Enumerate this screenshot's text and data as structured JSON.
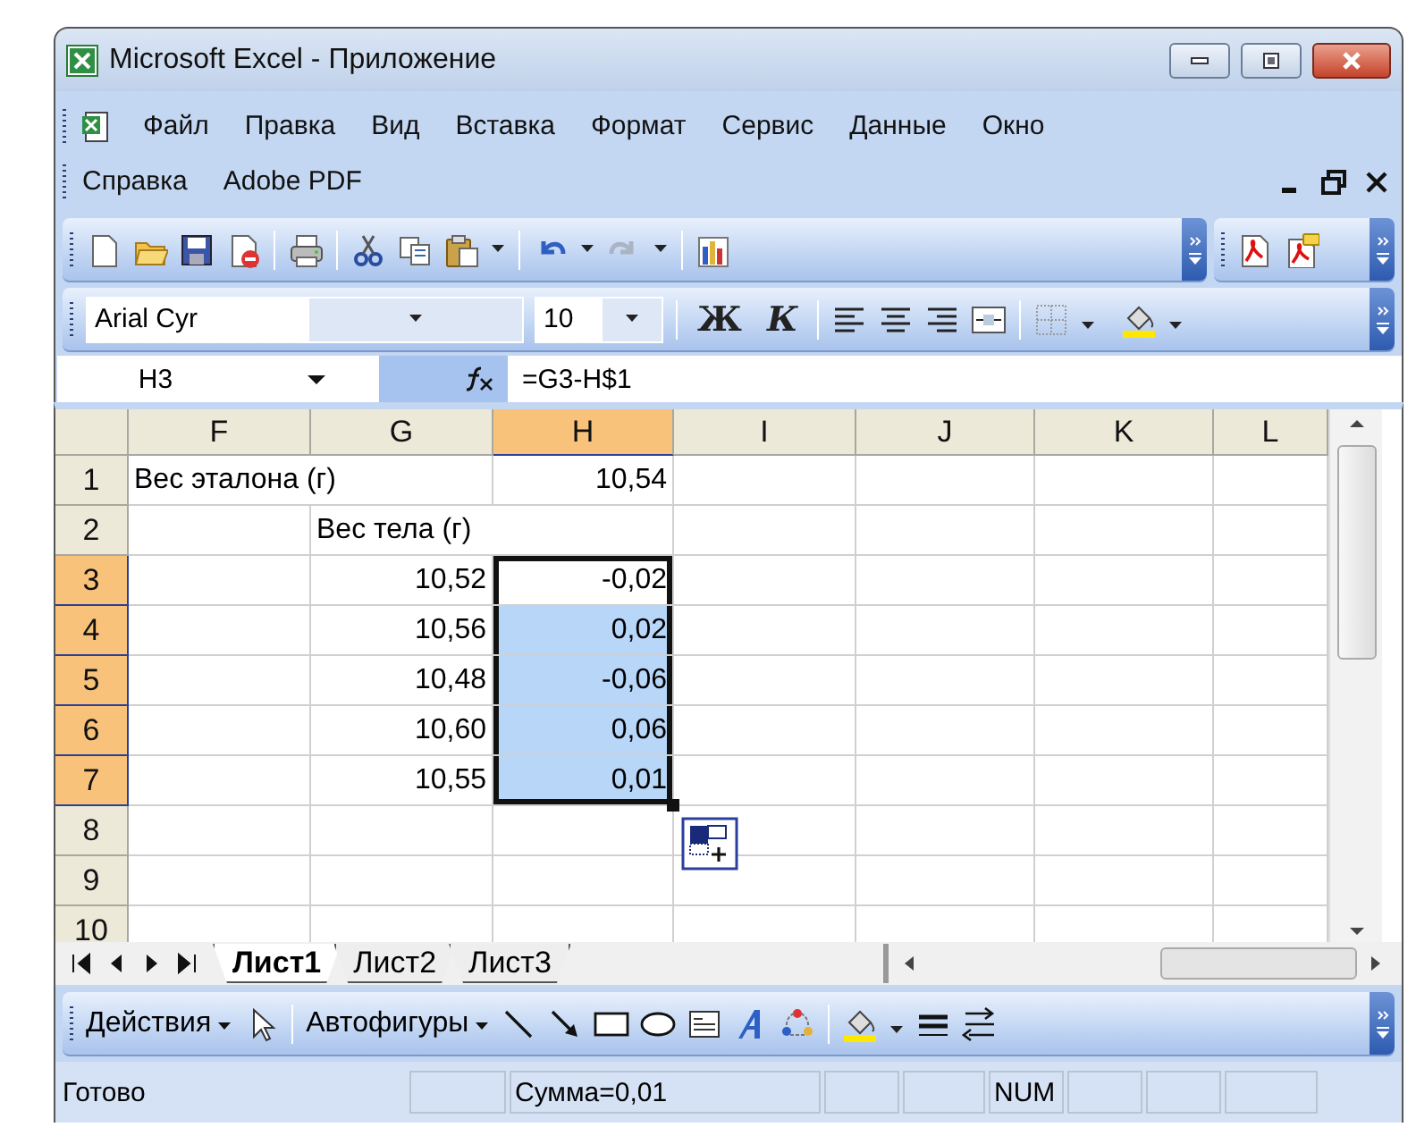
{
  "window": {
    "title": "Microsoft Excel - Приложение"
  },
  "menu": {
    "items": [
      "Файл",
      "Правка",
      "Вид",
      "Вставка",
      "Формат",
      "Сервис",
      "Данные",
      "Окно",
      "Справка",
      "Adobe PDF"
    ]
  },
  "format_bar": {
    "font": "Arial Cyr",
    "size": "10",
    "bold_label": "Ж",
    "italic_label": "К"
  },
  "formula_bar": {
    "name_box": "H3",
    "formula": "=G3-H$1"
  },
  "grid": {
    "columns": [
      {
        "label": "F",
        "selected": false
      },
      {
        "label": "G",
        "selected": false
      },
      {
        "label": "H",
        "selected": true
      },
      {
        "label": "I",
        "selected": false
      },
      {
        "label": "J",
        "selected": false
      },
      {
        "label": "K",
        "selected": false
      },
      {
        "label": "L",
        "selected": false
      }
    ],
    "rows": [
      {
        "header": "1",
        "selected": false,
        "cells": [
          {
            "text": "Вес эталона (г)",
            "kind": "text",
            "selected": false
          },
          null,
          {
            "text": "10,54",
            "kind": "number",
            "selected": false
          },
          null,
          null,
          null,
          null
        ]
      },
      {
        "header": "2",
        "selected": false,
        "cells": [
          null,
          {
            "text": "Вес тела (г)",
            "kind": "text",
            "selected": false
          },
          null,
          null,
          null,
          null,
          null
        ]
      },
      {
        "header": "3",
        "selected": true,
        "cells": [
          null,
          {
            "text": "10,52",
            "kind": "number",
            "selected": false
          },
          {
            "text": "-0,02",
            "kind": "number",
            "selected": true,
            "active": true
          },
          null,
          null,
          null,
          null
        ]
      },
      {
        "header": "4",
        "selected": true,
        "cells": [
          null,
          {
            "text": "10,56",
            "kind": "number",
            "selected": false
          },
          {
            "text": "0,02",
            "kind": "number",
            "selected": true,
            "active": false
          },
          null,
          null,
          null,
          null
        ]
      },
      {
        "header": "5",
        "selected": true,
        "cells": [
          null,
          {
            "text": "10,48",
            "kind": "number",
            "selected": false
          },
          {
            "text": "-0,06",
            "kind": "number",
            "selected": true,
            "active": false
          },
          null,
          null,
          null,
          null
        ]
      },
      {
        "header": "6",
        "selected": true,
        "cells": [
          null,
          {
            "text": "10,60",
            "kind": "number",
            "selected": false
          },
          {
            "text": "0,06",
            "kind": "number",
            "selected": true,
            "active": false
          },
          null,
          null,
          null,
          null
        ]
      },
      {
        "header": "7",
        "selected": true,
        "cells": [
          null,
          {
            "text": "10,55",
            "kind": "number",
            "selected": false
          },
          {
            "text": "0,01",
            "kind": "number",
            "selected": true,
            "active": false
          },
          null,
          null,
          null,
          null
        ]
      },
      {
        "header": "8",
        "selected": false,
        "cells": [
          null,
          null,
          null,
          null,
          null,
          null,
          null
        ]
      },
      {
        "header": "9",
        "selected": false,
        "cells": [
          null,
          null,
          null,
          null,
          null,
          null,
          null
        ]
      },
      {
        "header": "10",
        "selected": false,
        "cells": [
          null,
          null,
          null,
          null,
          null,
          null,
          null
        ]
      }
    ]
  },
  "sheet_tabs": [
    {
      "label": "Лист1",
      "selected": true
    },
    {
      "label": "Лист2",
      "selected": false
    },
    {
      "label": "Лист3",
      "selected": false
    }
  ],
  "drawing_bar": {
    "actions": "Действия",
    "autoshapes": "Автофигуры"
  },
  "status_bar": {
    "state": "Готово",
    "sum": "Сумма=0,01",
    "num": "NUM"
  }
}
